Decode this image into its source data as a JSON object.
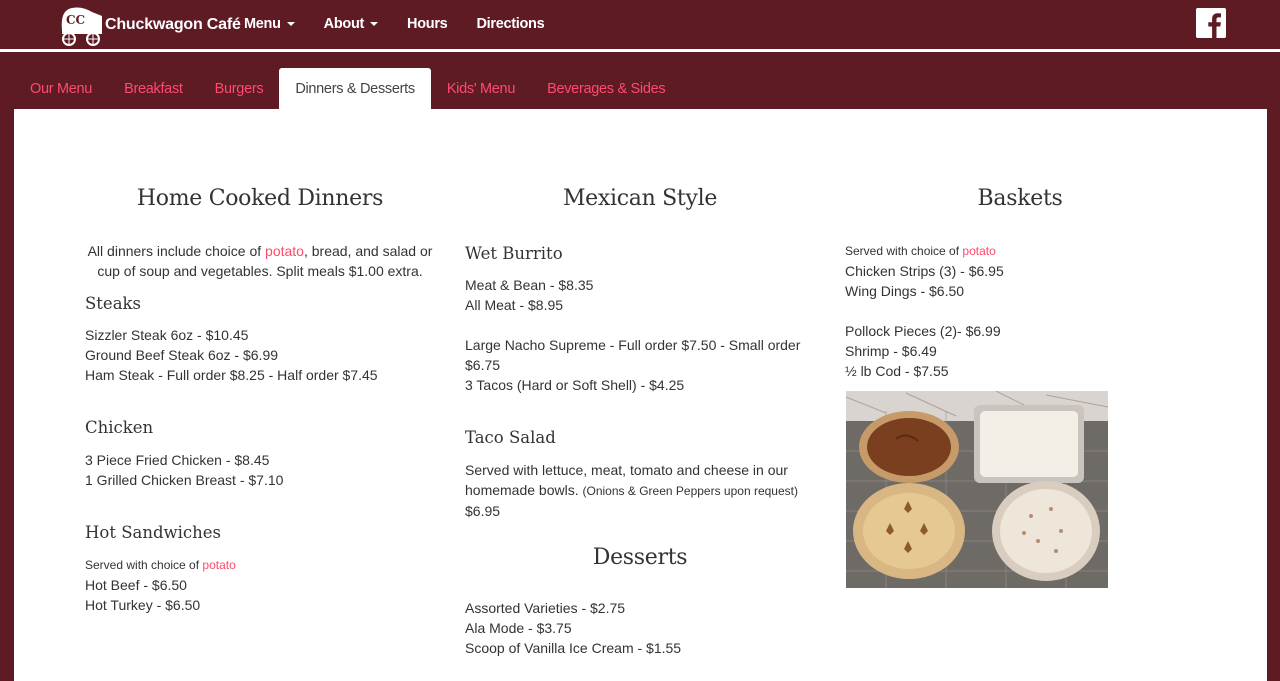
{
  "nav": {
    "brand": "Chuckwagon Café",
    "logo_initials": "CC",
    "links": [
      {
        "label": "Menu",
        "dropdown": true
      },
      {
        "label": "About",
        "dropdown": true
      },
      {
        "label": "Hours",
        "dropdown": false
      },
      {
        "label": "Directions",
        "dropdown": false
      }
    ],
    "social_icon": "facebook-icon"
  },
  "tabs": [
    "Our Menu",
    "Breakfast",
    "Burgers",
    "Dinners & Desserts",
    "Kids' Menu",
    "Beverages & Sides"
  ],
  "active_tab": "Dinners & Desserts",
  "colors": {
    "maroon": "#5e1b24",
    "accent": "#ff4a6e"
  },
  "dinners": {
    "title": "Home Cooked Dinners",
    "intro_pre": "All dinners include choice of ",
    "intro_link": "potato",
    "intro_post": ", bread, and salad or cup of soup and vegetables. Split meals $1.00 extra.",
    "steaks": {
      "title": "Steaks",
      "items": [
        "Sizzler Steak 6oz - $10.45",
        "Ground Beef Steak 6oz - $6.99",
        "Ham Steak - Full order $8.25 - Half order $7.45"
      ]
    },
    "chicken": {
      "title": "Chicken",
      "items": [
        "3 Piece Fried Chicken - $8.45",
        "1 Grilled Chicken Breast - $7.10"
      ]
    },
    "sandwiches": {
      "title": "Hot Sandwiches",
      "note_pre": "Served with choice of ",
      "note_link": "potato",
      "items": [
        "Hot Beef - $6.50",
        "Hot Turkey - $6.50"
      ]
    }
  },
  "mexican": {
    "title": "Mexican Style",
    "burrito": {
      "title": "Wet Burrito",
      "items": [
        "Meat & Bean - $8.35",
        "All Meat - $8.95"
      ]
    },
    "nacho": "Large Nacho Supreme - Full order $7.50 - Small order $6.75",
    "tacos": "3 Tacos (Hard or Soft Shell) - $4.25",
    "taco_salad": {
      "title": "Taco Salad",
      "desc": "Served with lettuce, meat, tomato and cheese in our homemade bowls. ",
      "note": "(Onions & Green Peppers upon request)",
      "price": "$6.95"
    }
  },
  "desserts": {
    "title": "Desserts",
    "items": [
      "Assorted Varieties - $2.75",
      "Ala Mode - $3.75",
      "Scoop of Vanilla Ice Cream - $1.55"
    ]
  },
  "baskets": {
    "title": "Baskets",
    "note_pre": "Served with choice of ",
    "note_link": "potato",
    "items_a": [
      "Chicken Strips (3) - $6.95",
      "Wing Dings - $6.50"
    ],
    "items_b": [
      "Pollock Pieces (2)- $6.99",
      "Shrimp - $6.49",
      "½ lb Cod - $7.55"
    ]
  }
}
